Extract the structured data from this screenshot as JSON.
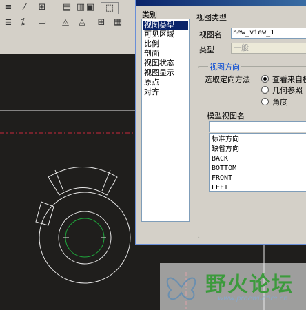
{
  "dialog": {
    "category_header": "类别",
    "categories": [
      "视图类型",
      "可见区域",
      "比例",
      "剖面",
      "视图状态",
      "视图显示",
      "原点",
      "对齐"
    ],
    "selected_category": 0,
    "section_title": "视图类型",
    "view_name_label": "视图名",
    "view_name_value": "new_view_1",
    "type_label": "类型",
    "type_value": "一般",
    "orientation_group_label": "视图方向",
    "orientation_method_label": "选取定向方法",
    "orientation_options": [
      "查看来自模",
      "几何参照",
      "角度"
    ],
    "model_view_names_label": "模型视图名",
    "model_views": [
      "标准方向",
      "缺省方向",
      "BACK",
      "BOTTOM",
      "FRONT",
      "LEFT"
    ]
  },
  "watermark": {
    "brand": "野火论坛",
    "url": "www.proewildfire.cn"
  },
  "colors": {
    "selection": "#0a246a",
    "group_label": "#0046d5",
    "canvas": "#1f1e1c",
    "dialog_face": "#d4d0c8",
    "geometry": "#e8e8e8",
    "green_circle": "#1ea83c",
    "red_dashed_line": "#c8283c",
    "watermark_text": "#3c9a3c"
  },
  "toolbar_icons": [
    "text-icon",
    "hatch-icon",
    "dimension-icon",
    "symbol-icon",
    "datum-icon",
    "table-icon",
    "binoculars-icon",
    "window-icon"
  ]
}
